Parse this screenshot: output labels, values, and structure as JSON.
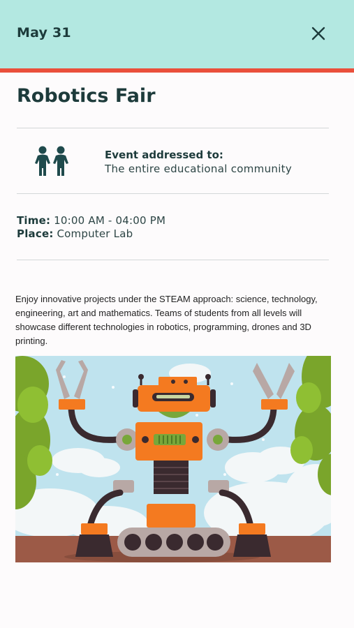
{
  "header": {
    "date": "May 31",
    "close_icon": "close-icon"
  },
  "colors": {
    "header_bg": "#b3e8e1",
    "accent": "#ea4f3b",
    "text_dark": "#1d3b3b"
  },
  "event": {
    "title": "Robotics Fair",
    "audience_icon": "children-icon",
    "audience_label": "Event addressed to:",
    "audience_value": "The entire educational community",
    "time_label": "Time:",
    "time_value": "10:00 AM - 04:00 PM",
    "place_label": "Place:",
    "place_value": "Computer Lab",
    "description": "Enjoy innovative projects under the STEAM approach: science, technology, engineering, art and mathematics. Teams of students from all levels will showcase different technologies in robotics, programming, drones and 3D printing.",
    "image": "robot-illustration"
  }
}
